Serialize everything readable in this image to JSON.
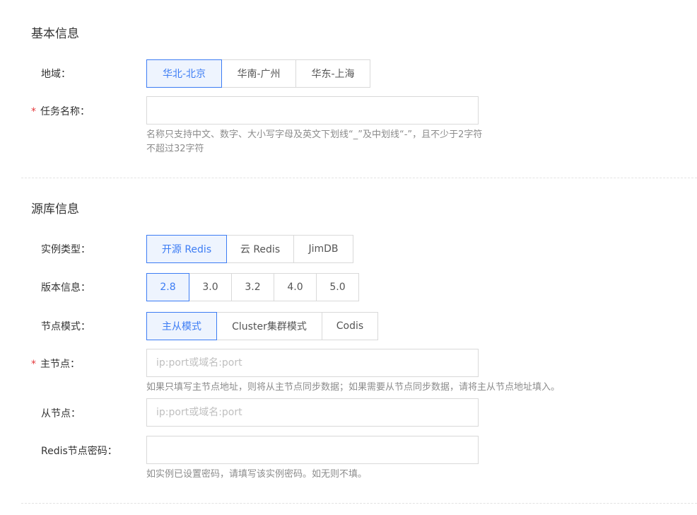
{
  "basic": {
    "title": "基本信息",
    "region": {
      "label": "地域：",
      "options": [
        "华北-北京",
        "华南-广州",
        "华东-上海"
      ],
      "selected": "华北-北京"
    },
    "task_name": {
      "required_mark": "*",
      "label": "任务名称：",
      "value": "",
      "placeholder": "",
      "hint_line1": "名称只支持中文、数字、大小写字母及英文下划线“_”及中划线“-”，且不少于2字符",
      "hint_line2": "不超过32字符"
    }
  },
  "source": {
    "title": "源库信息",
    "instance_type": {
      "label": "实例类型：",
      "options": [
        "开源 Redis",
        "云 Redis",
        "JimDB"
      ],
      "selected": "开源 Redis"
    },
    "version": {
      "label": "版本信息：",
      "options": [
        "2.8",
        "3.0",
        "3.2",
        "4.0",
        "5.0"
      ],
      "selected": "2.8"
    },
    "node_mode": {
      "label": "节点模式：",
      "options": [
        "主从模式",
        "Cluster集群模式",
        "Codis"
      ],
      "selected": "主从模式"
    },
    "master_node": {
      "required_mark": "*",
      "label": "主节点：",
      "value": "",
      "placeholder": "ip:port或域名:port",
      "hint": "如果只填写主节点地址，则将从主节点同步数据；如果需要从节点同步数据，请将主从节点地址填入。"
    },
    "slave_node": {
      "label": "从节点：",
      "value": "",
      "placeholder": "ip:port或域名:port"
    },
    "redis_password": {
      "label": "Redis节点密码：",
      "value": "",
      "placeholder": "",
      "hint": "如实例已设置密码，请填写该实例密码。如无则不填。"
    }
  }
}
